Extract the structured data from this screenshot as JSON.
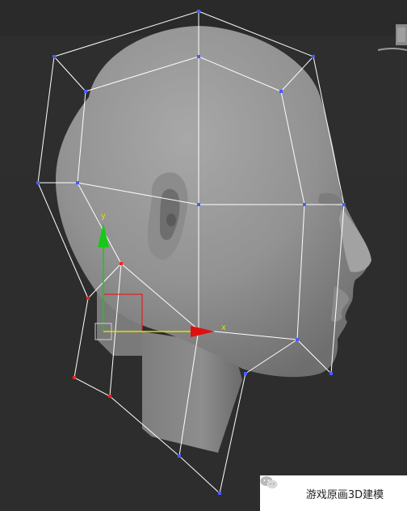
{
  "viewport": {
    "name": "3d-viewport",
    "background_color": "#2e2e2e",
    "model_color": "#9a9a9a",
    "wire_color": "#ffffff",
    "vertex_color": "#4a5cff",
    "selected_vertex_color": "#ff2020"
  },
  "gizmo": {
    "y_axis_color": "#18c818",
    "x_axis_color": "#e0e000",
    "x_arrow_color": "#e01010",
    "y_label": "y",
    "x_label": "x",
    "plane_handle_color": "#e02020"
  },
  "watermark": {
    "icon": "wechat-icon",
    "text": "游戏原画3D建模"
  },
  "corner_widget": {
    "icon": "viewcube-icon"
  }
}
